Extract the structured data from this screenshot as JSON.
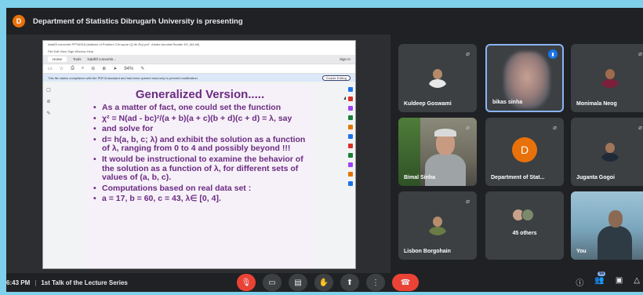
{
  "presenter": {
    "avatar_letter": "D",
    "text": "Department of Statistics Dibrugarh University is presenting"
  },
  "pdf": {
    "title_bar": "lsdaf0f convertet PPTsDDA (stations of Problem Chi-squre (Q ite 2k)) pdf · Adobe Acrobat Reader DC (64-bit)",
    "menu": "File  Edit  View  Sign  Window  Help",
    "tabs": [
      "Home",
      "Tools",
      "lsdaf0f convertin..."
    ],
    "sign_in": "Sign In",
    "notice": "This file claims compliance with the PDF/A standard and has been opened read-only to prevent modification.",
    "enable_editing": "Enable Editing",
    "zoom": "94%"
  },
  "slide": {
    "title": "Generalized Version.....",
    "bullets": [
      "As a matter of fact, one could set the function",
      "χ² = N(ad - bc)²/(a + b)(a + c)(b + d)(c + d) = λ, say",
      "and solve for",
      "d= h(a, b, c; λ) and exhibit the solution as a function of λ, ranging from 0 to 4 and possibly beyond !!!",
      "It would be instructional to examine the behavior of the solution as a function of λ, for different sets of values of (a, b, c).",
      "Computations based on real data set :",
      "a = 17, b = 60, c = 43, λ∈ [0, 4]."
    ]
  },
  "participants": {
    "kuldeep": "Kuldeep Goswami",
    "bikas": "bikas sinha",
    "monimala": "Monimala Neog",
    "bimal": "Bimal Sinha",
    "dept": "Department of Stat...",
    "dept_letter": "D",
    "juganta": "Juganta Gogoi",
    "lisbon": "Lisbon Borgohain",
    "others": "45 others",
    "you": "You"
  },
  "meeting": {
    "time": "6:43 PM",
    "separator": "|",
    "name": "1st Talk of the Lecture Series",
    "people_count": "54"
  },
  "colors": {
    "slide_text": "#6b2b82",
    "hangup": "#ea4335",
    "presenter_avatar": "#e8710a"
  }
}
